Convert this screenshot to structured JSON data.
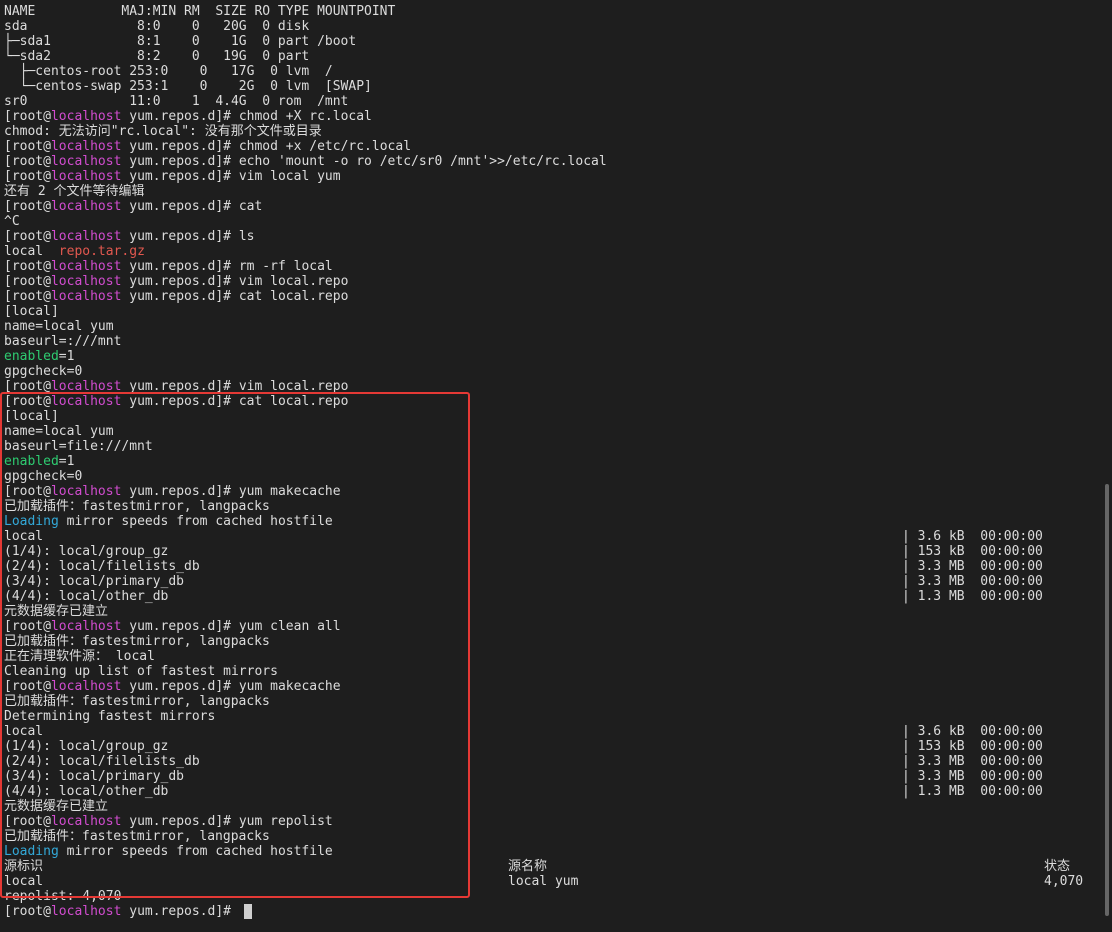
{
  "terminal": {
    "prompt": {
      "user_prefix": "[root@",
      "host": "localhost",
      "path_suffix": " yum.repos.d]# "
    },
    "lines": [
      {
        "text": "NAME           MAJ:MIN RM  SIZE RO TYPE MOUNTPOINT"
      },
      {
        "text": "sda              8:0    0   20G  0 disk"
      },
      {
        "text": "├─sda1           8:1    0    1G  0 part /boot"
      },
      {
        "text": "└─sda2           8:2    0   19G  0 part"
      },
      {
        "text": "  ├─centos-root 253:0    0   17G  0 lvm  /"
      },
      {
        "text": "  └─centos-swap 253:1    0    2G  0 lvm  [SWAP]"
      },
      {
        "text": "sr0             11:0    1  4.4G  0 rom  /mnt"
      },
      {
        "cmd": "chmod +X rc.local"
      },
      {
        "text": "chmod: 无法访问\"rc.local\": 没有那个文件或目录"
      },
      {
        "cmd": "chmod +x /etc/rc.local"
      },
      {
        "cmd": "echo 'mount -o ro /etc/sr0 /mnt'>>/etc/rc.local"
      },
      {
        "cmd": "vim local yum"
      },
      {
        "text": "还有 2 个文件等待编辑"
      },
      {
        "cmd": "cat"
      },
      {
        "text": "^C"
      },
      {
        "cmd": "ls"
      },
      {
        "parts": [
          {
            "t": "local  "
          },
          {
            "t": "repo.tar.gz",
            "c": "red"
          }
        ]
      },
      {
        "cmd": "rm -rf local"
      },
      {
        "cmd": "vim local.repo"
      },
      {
        "cmd": "cat local.repo"
      },
      {
        "text": "[local]"
      },
      {
        "text": "name=local yum"
      },
      {
        "text": "baseurl=:///mnt"
      },
      {
        "parts": [
          {
            "t": "enabled",
            "c": "green"
          },
          {
            "t": "=1"
          }
        ]
      },
      {
        "text": "gpgcheck=0"
      },
      {
        "cmd": "vim local.repo"
      },
      {
        "cmd": "cat local.repo"
      },
      {
        "text": "[local]"
      },
      {
        "text": "name=local yum"
      },
      {
        "text": "baseurl=file:///mnt"
      },
      {
        "parts": [
          {
            "t": "enabled",
            "c": "green"
          },
          {
            "t": "=1"
          }
        ]
      },
      {
        "text": "gpgcheck=0"
      },
      {
        "cmd": "yum makecache"
      },
      {
        "text": "已加载插件：fastestmirror, langpacks"
      },
      {
        "parts": [
          {
            "t": "Loading",
            "c": "blue"
          },
          {
            "t": " mirror speeds from cached hostfile"
          }
        ]
      },
      {
        "text": "local",
        "right": "| 3.6 kB  00:00:00"
      },
      {
        "text": "(1/4): local/group_gz",
        "right": "| 153 kB  00:00:00"
      },
      {
        "text": "(2/4): local/filelists_db",
        "right": "| 3.3 MB  00:00:00"
      },
      {
        "text": "(3/4): local/primary_db",
        "right": "| 3.3 MB  00:00:00"
      },
      {
        "text": "(4/4): local/other_db",
        "right": "| 1.3 MB  00:00:00"
      },
      {
        "text": "元数据缓存已建立"
      },
      {
        "cmd": "yum clean all"
      },
      {
        "text": "已加载插件：fastestmirror, langpacks"
      },
      {
        "text": "正在清理软件源： local"
      },
      {
        "text": "Cleaning up list of fastest mirrors"
      },
      {
        "cmd": "yum makecache"
      },
      {
        "text": "已加载插件：fastestmirror, langpacks"
      },
      {
        "text": "Determining fastest mirrors"
      },
      {
        "text": "local",
        "right": "| 3.6 kB  00:00:00"
      },
      {
        "text": "(1/4): local/group_gz",
        "right": "| 153 kB  00:00:00"
      },
      {
        "text": "(2/4): local/filelists_db",
        "right": "| 3.3 MB  00:00:00"
      },
      {
        "text": "(3/4): local/primary_db",
        "right": "| 3.3 MB  00:00:00"
      },
      {
        "text": "(4/4): local/other_db",
        "right": "| 1.3 MB  00:00:00"
      },
      {
        "text": "元数据缓存已建立"
      },
      {
        "cmd": "yum repolist"
      },
      {
        "text": "已加载插件：fastestmirror, langpacks"
      },
      {
        "parts": [
          {
            "t": "Loading",
            "c": "blue"
          },
          {
            "t": " mirror speeds from cached hostfile"
          }
        ]
      },
      {
        "text": "源标识",
        "mid": "源名称",
        "end": "状态"
      },
      {
        "text": "local",
        "mid": "local yum",
        "end": "4,070"
      },
      {
        "text": "repolist: 4,070"
      },
      {
        "cmd": "",
        "cursor": true
      }
    ]
  }
}
